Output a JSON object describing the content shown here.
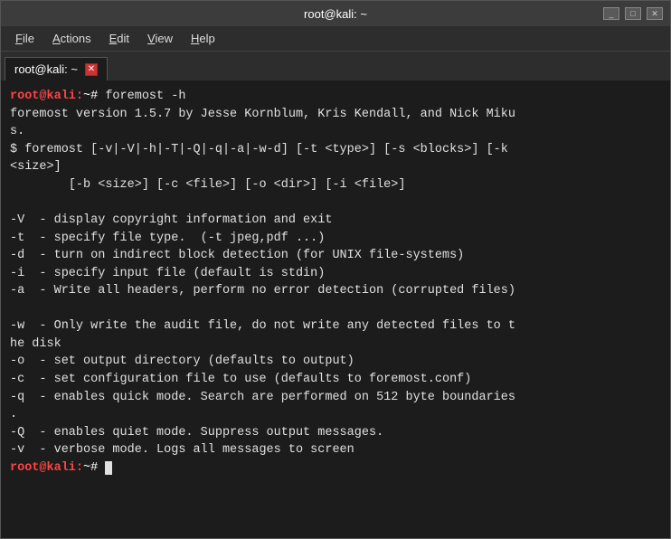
{
  "window": {
    "title": "root@kali: ~",
    "controls": {
      "minimize": "_",
      "maximize": "□",
      "close": "✕"
    }
  },
  "menubar": {
    "items": [
      {
        "label": "File",
        "underline_index": 0
      },
      {
        "label": "Actions",
        "underline_index": 0
      },
      {
        "label": "Edit",
        "underline_index": 0
      },
      {
        "label": "View",
        "underline_index": 0
      },
      {
        "label": "Help",
        "underline_index": 0
      }
    ]
  },
  "tab": {
    "label": "root@kali: ~"
  },
  "terminal": {
    "prompt_label": "root@kali:",
    "prompt_suffix": "~#",
    "command": " foremost -h",
    "output_lines": [
      "foremost version 1.5.7 by Jesse Kornblum, Kris Kendall, and Nick Miku",
      "s.",
      "$ foremost [-v|-V|-h|-T|-Q|-q|-a|-w-d] [-t <type>] [-s <blocks>] [-k",
      "<size>]",
      "        [-b <size>] [-c <file>] [-o <dir>] [-i <file>]",
      "",
      "-V  - display copyright information and exit",
      "-t  - specify file type.  (-t jpeg,pdf ...)",
      "-d  - turn on indirect block detection (for UNIX file-systems)",
      "-i  - specify input file (default is stdin)",
      "-a  - Write all headers, perform no error detection (corrupted files)",
      "",
      "-w  - Only write the audit file, do not write any detected files to t",
      "he disk",
      "-o  - set output directory (defaults to output)",
      "-c  - set configuration file to use (defaults to foremost.conf)",
      "-q  - enables quick mode. Search are performed on 512 byte boundaries",
      ".",
      "-Q  - enables quiet mode. Suppress output messages.",
      "-v  - verbose mode. Logs all messages to screen"
    ],
    "final_prompt_label": "root@kali:",
    "final_prompt_suffix": "~#"
  }
}
